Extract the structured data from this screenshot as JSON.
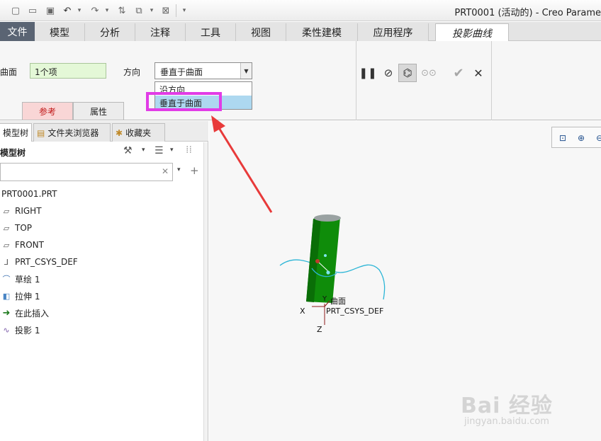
{
  "window": {
    "title": "PRT0001 (活动的) - Creo Parame"
  },
  "quick_access": {
    "icons": [
      "new-icon",
      "open-icon",
      "save-icon",
      "undo-icon",
      "redo-icon",
      "regenerate-icon",
      "windows-icon",
      "close-window-icon",
      "customize-icon"
    ],
    "dropdown_glyph": "▾"
  },
  "tabs": [
    {
      "label": "文件"
    },
    {
      "label": "模型"
    },
    {
      "label": "分析"
    },
    {
      "label": "注释"
    },
    {
      "label": "工具"
    },
    {
      "label": "视图"
    },
    {
      "label": "柔性建模"
    },
    {
      "label": "应用程序"
    },
    {
      "label": "投影曲线"
    }
  ],
  "ribbon": {
    "surface_label": "曲面",
    "surface_value": "1个项",
    "direction_label": "方向",
    "direction_value": "垂直于曲面",
    "direction_options": [
      "沿方向",
      "垂直于曲面"
    ],
    "subtabs": [
      "参考",
      "属性"
    ],
    "action_icons": [
      "pause-icon",
      "no-preview-icon",
      "verify-icon",
      "glasses-icon",
      "confirm-icon",
      "cancel-icon"
    ]
  },
  "panel": {
    "tabs": [
      "模型树",
      "文件夹浏览器",
      "收藏夹"
    ],
    "header_title": "模型树",
    "search_placeholder": "",
    "tree": [
      {
        "label": "PRT0001.PRT",
        "icon": "part-icon"
      },
      {
        "label": "RIGHT",
        "icon": "datum-plane-icon"
      },
      {
        "label": "TOP",
        "icon": "datum-plane-icon"
      },
      {
        "label": "FRONT",
        "icon": "datum-plane-icon"
      },
      {
        "label": "PRT_CSYS_DEF",
        "icon": "csys-icon"
      },
      {
        "label": "草绘 1",
        "icon": "sketch-icon"
      },
      {
        "label": "拉伸 1",
        "icon": "extrude-icon"
      },
      {
        "label": "在此插入",
        "icon": "insert-arrow-icon"
      },
      {
        "label": "投影 1",
        "icon": "projection-icon"
      }
    ]
  },
  "viewport": {
    "labels": {
      "surface": "曲面",
      "csys": "PRT_CSYS_DEF",
      "x": "X",
      "y": "Y",
      "z": "Z"
    },
    "toolbar_icons": [
      "refit-icon",
      "zoom-in-icon",
      "zoom-out-icon"
    ]
  },
  "watermark": {
    "logo": "Bai 经验",
    "url": "jingyan.baidu.com"
  },
  "colors": {
    "cylinder": "#0f8c0a",
    "curve": "#2bb5d6",
    "highlight": "#e13ce6",
    "arrow": "#e83a3a",
    "surface_field": "#e4f8d7"
  }
}
